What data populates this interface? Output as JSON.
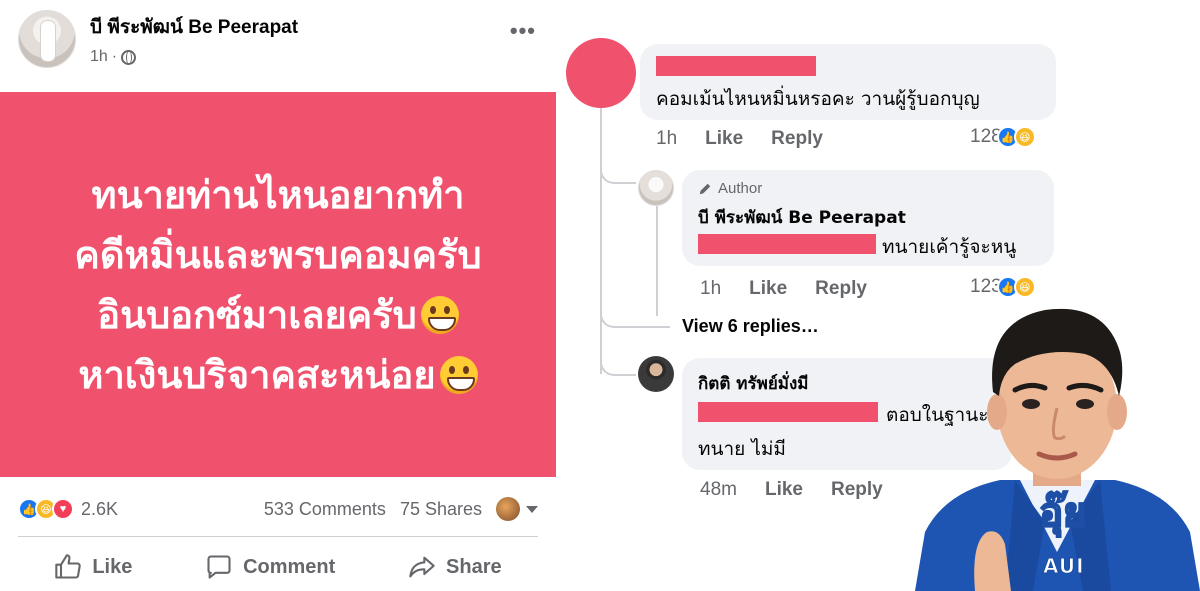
{
  "post": {
    "page_name": "บี พีระพัฒน์ Be Peerapat",
    "time": "1h",
    "more_icon": "more-horizontal-icon",
    "card_lines": [
      "ทนายท่านไหนอยากทำ",
      "คดีหมิ่นและพรบคอมครับ",
      "อินบอกซ์มาเลยครับ",
      "หาเงินบริจาคสะหน่อย"
    ],
    "card_color": "#f0516d",
    "reaction_count": "2.6K",
    "comments_count": "533 Comments",
    "shares_count": "75 Shares",
    "actions": {
      "like": "Like",
      "comment": "Comment",
      "share": "Share"
    }
  },
  "comments": [
    {
      "text": "คอมเม้นไหนหมิ่นหรอคะ วานผู้รู้บอกบุญ",
      "time": "1h",
      "like": "Like",
      "reply": "Reply",
      "reaction_count": "128"
    },
    {
      "badge": "Author",
      "name": "บี พีระพัฒน์ Be Peerapat",
      "text": "ทนายเค้ารู้จะหนู",
      "time": "1h",
      "like": "Like",
      "reply": "Reply",
      "reaction_count": "123"
    },
    {
      "name": "กิตติ ทรัพย์มั่งมี",
      "text_line1": "ตอบในฐานะ",
      "text_line2": "ทนาย ไม่มี",
      "time": "48m",
      "like": "Like",
      "reply": "Reply"
    }
  ],
  "view_replies": "View 6 replies…",
  "overlay": {
    "caption_thai": "อุ๊ย",
    "caption_en": "AUI"
  },
  "colors": {
    "redaction": "#f0516d",
    "like_blue": "#1877f2",
    "haha_yellow": "#f7b928",
    "love_red": "#f33e58"
  }
}
